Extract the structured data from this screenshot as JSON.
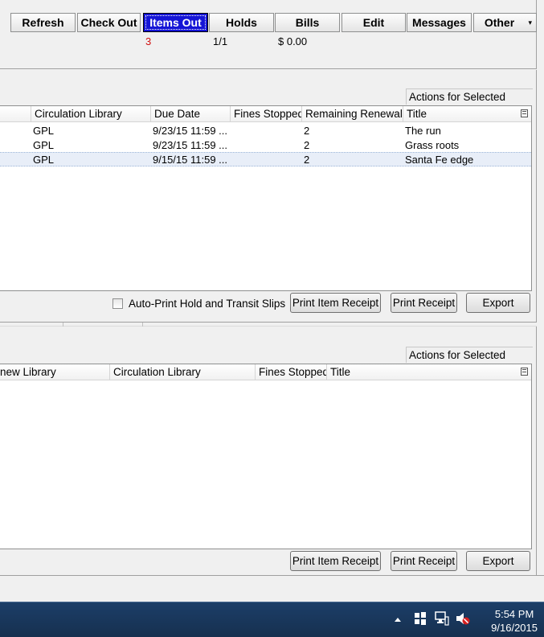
{
  "toolbar": {
    "buttons": [
      {
        "label": "Refresh",
        "mnemonic_underline": "R",
        "active": false
      },
      {
        "label": "Check Out",
        "active": false
      },
      {
        "label": "Items Out",
        "active": true
      },
      {
        "label": "Holds",
        "active": false
      },
      {
        "label": "Bills",
        "active": false
      },
      {
        "label": "Edit",
        "active": false
      },
      {
        "label": "Messages",
        "active": false
      },
      {
        "label": "Other",
        "active": false
      }
    ],
    "counts": {
      "items_out": "3",
      "holds": "1/1",
      "bills": "$ 0.00"
    },
    "counts_color": "#d01010"
  },
  "items_out_panel": {
    "actions_label": "Actions for Selected Items",
    "columns": [
      "Circulation Library",
      "Due Date",
      "Fines Stopped",
      "Remaining Renewals",
      "Title"
    ],
    "rows": [
      {
        "circ_lib": "GPL",
        "due_date": "9/23/15 11:59 ...",
        "fines_stopped": "",
        "renewals": "2",
        "title": "The run"
      },
      {
        "circ_lib": "GPL",
        "due_date": "9/23/15 11:59 ...",
        "fines_stopped": "",
        "renewals": "2",
        "title": "Grass roots"
      },
      {
        "circ_lib": "GPL",
        "due_date": "9/15/15 11:59 ...",
        "fines_stopped": "",
        "renewals": "2",
        "title": "Santa Fe edge",
        "selected": true
      }
    ],
    "checkbox_label": "Auto-Print Hold and Transit Slips",
    "checkbox_checked": false,
    "buttons": {
      "print_item_receipt": "Print Item Receipt",
      "print_receipt": "Print Receipt",
      "export": "Export"
    }
  },
  "lower_panel": {
    "actions_label": "Actions for Selected Items",
    "columns": [
      "new Library",
      "Circulation Library",
      "Fines Stopped",
      "Title"
    ],
    "rows": [],
    "buttons": {
      "print_item_receipt": "Print Item Receipt",
      "print_receipt": "Print Receipt",
      "export": "Export"
    }
  },
  "taskbar": {
    "time": "5:54 PM",
    "date": "9/16/2015",
    "tray_icons": [
      "show-hidden-icons-icon",
      "action-center-flag-icon",
      "network-icon",
      "volume-muted-icon"
    ]
  },
  "colors": {
    "active_tab": "#1515d6",
    "taskbar": "#1c3e68",
    "selected_row": "#e8eef8"
  }
}
